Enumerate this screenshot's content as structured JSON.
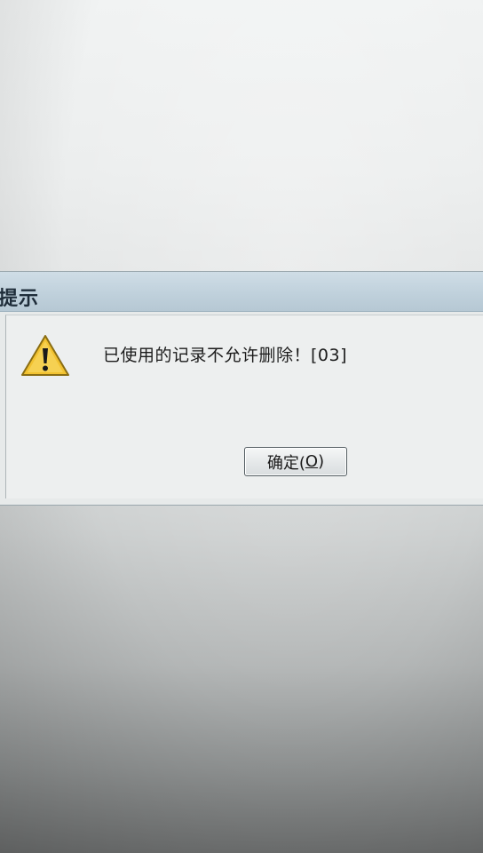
{
  "dialog": {
    "title": "提示",
    "icon": "warning-icon",
    "message": "已使用的记录不允许删除！[03]",
    "ok_button": {
      "label_prefix": "确定(",
      "hotkey": "O",
      "label_suffix": ")"
    }
  },
  "colors": {
    "title_bar": "#c0d1dc",
    "dialog_background": "#edefef",
    "warning_yellow": "#f2c230"
  }
}
